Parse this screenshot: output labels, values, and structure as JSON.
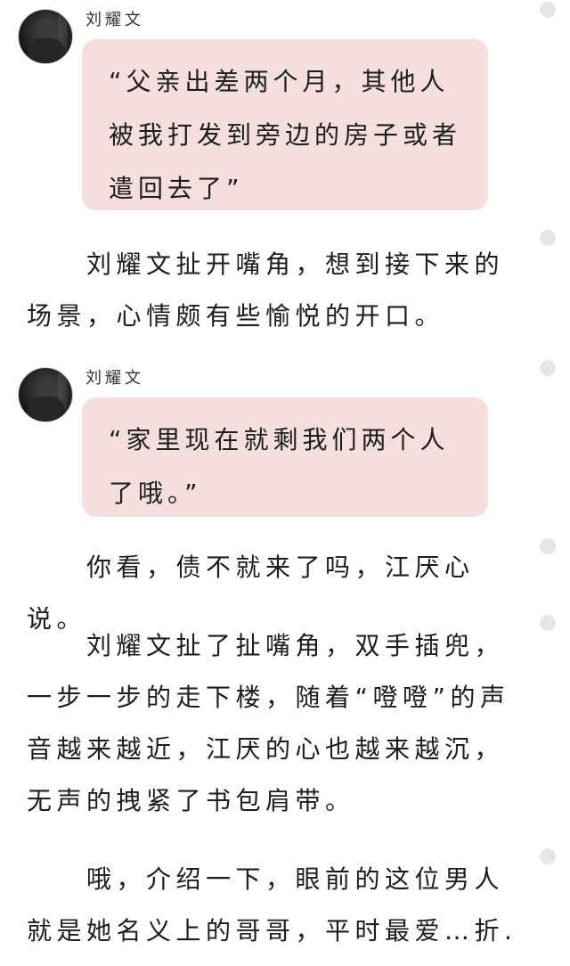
{
  "messages": [
    {
      "speaker": "刘耀文",
      "avatar_icon": "user-avatar-photo",
      "text": "“父亲出差两个月，其他人被我打发到旁边的房子或者遣回去了”"
    },
    {
      "speaker": "刘耀文",
      "avatar_icon": "user-avatar-photo",
      "text": "“家里现在就剩我们两个人了哦。”"
    }
  ],
  "paragraphs": [
    "　　刘耀文扯开嘴角，想到接下来的场景，心情颇有些愉悦的开口。",
    "　　你看，债不就来了吗，江厌心说。",
    "　　刘耀文扯了扯嘴角，双手插兜，一步一步的走下楼，随着“噔噔”的声音越来越近，江厌的心也越来越沉，无声的拽紧了书包肩带。",
    "　　哦，介绍一下，眼前的这位男人就是她名义上的哥哥，平时最爱…折.弄她。"
  ],
  "colors": {
    "bubble_bg": "#f4dede",
    "text": "#1d1d1d",
    "dot": "#e6e6e6"
  }
}
